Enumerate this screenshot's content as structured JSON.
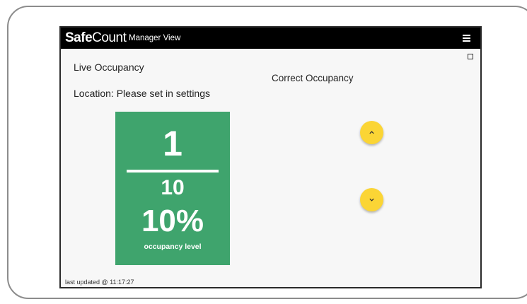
{
  "header": {
    "brand_bold": "Safe",
    "brand_light": "Count",
    "view_label": "Manager View",
    "menu_icon": "hamburger-menu-icon"
  },
  "fullscreen_icon": "fullscreen-icon",
  "live": {
    "title": "Live Occupancy",
    "location": "Location: Please set in settings"
  },
  "occupancy": {
    "current": "1",
    "max": "10",
    "percent": "10%",
    "caption": "occupancy level",
    "card_color": "#3fa46d"
  },
  "correct": {
    "title": "Correct Occupancy",
    "up_icon": "chevron-up-icon",
    "down_icon": "chevron-down-icon",
    "button_color": "#fbd535"
  },
  "footer": {
    "updated": "last updated @ 11:17:27"
  }
}
